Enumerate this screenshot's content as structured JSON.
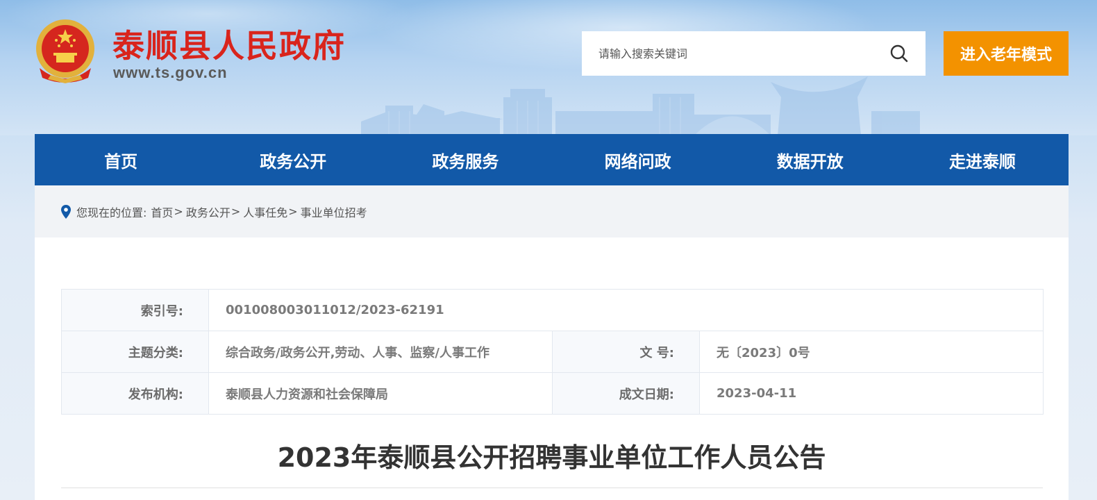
{
  "header": {
    "site_name": "泰顺县人民政府",
    "site_url": "www.ts.gov.cn",
    "search_placeholder": "请输入搜索关键词",
    "elder_mode_label": "进入老年模式"
  },
  "nav": {
    "items": [
      "首页",
      "政务公开",
      "政务服务",
      "网络问政",
      "数据开放",
      "走进泰顺"
    ]
  },
  "breadcrumb": {
    "prefix": "您现在的位置:",
    "items": [
      "首页",
      "政务公开",
      "人事任免",
      "事业单位招考"
    ],
    "separator": ">"
  },
  "meta": {
    "index_label": "索引号:",
    "index_value": "001008003011012/2023-62191",
    "topic_label": "主题分类:",
    "topic_value": "综合政务/政务公开,劳动、人事、监察/人事工作",
    "docno_label": "文 号:",
    "docno_value": "无〔2023〕0号",
    "publisher_label": "发布机构:",
    "publisher_value": "泰顺县人力资源和社会保障局",
    "date_label": "成文日期:",
    "date_value": "2023-04-11"
  },
  "article": {
    "title": "2023年泰顺县公开招聘事业单位工作人员公告"
  },
  "colors": {
    "nav_bg": "#1259a8",
    "elder_btn": "#f39200",
    "site_name": "#d9241c"
  }
}
